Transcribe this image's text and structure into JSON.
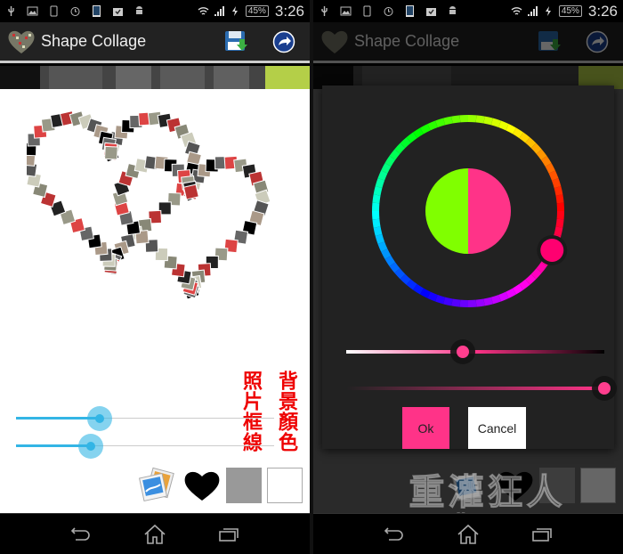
{
  "status_bar": {
    "notification_icons": [
      "usb-icon",
      "image-icon",
      "phone-icon",
      "alarm-icon",
      "screenshot-icon",
      "task-icon",
      "android-icon"
    ],
    "battery": "45%",
    "time": "3:26"
  },
  "action_bar": {
    "title": "Shape Collage",
    "actions": [
      "save-icon",
      "share-icon"
    ]
  },
  "editor": {
    "labels": {
      "photo_border": "照片框線",
      "background_color": "背景顏色"
    },
    "sliders": [
      {
        "name": "photo-size",
        "value": 0.32
      },
      {
        "name": "border-width",
        "value": 0.28
      }
    ],
    "tools": [
      "photos-icon",
      "heart-shape-icon",
      "border-color-swatch",
      "background-color-swatch"
    ],
    "swatch_colors": {
      "border": "#999999",
      "background": "#ffffff"
    }
  },
  "color_picker": {
    "old_color": "#80ff00",
    "new_color": "#ff3388",
    "hue_degrees": 335,
    "saturation_value": 0.45,
    "opacity": 1.0,
    "ok_label": "Ok",
    "cancel_label": "Cancel"
  },
  "nav_bar": {
    "buttons": [
      "back-icon",
      "home-icon",
      "recent-apps-icon"
    ]
  },
  "watermark": {
    "text": "重灌狂人",
    "url": "HTTP://BRIIAN.COM"
  },
  "colors": {
    "accent": "#33b5e5",
    "pink": "#ff3388",
    "label_red": "#ee0000"
  }
}
